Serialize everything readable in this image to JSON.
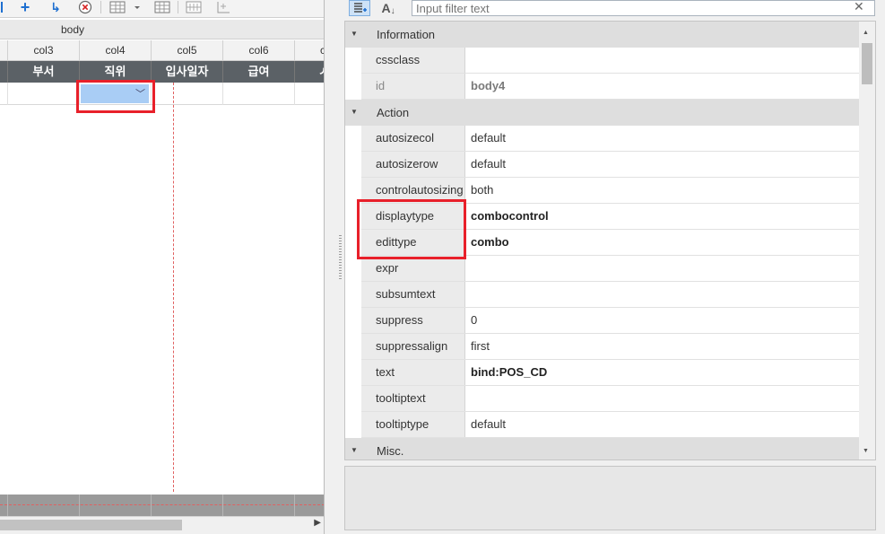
{
  "grid": {
    "band_label": "body",
    "columns": [
      "col3",
      "col4",
      "col5",
      "col6",
      "c"
    ],
    "headers": [
      "부서",
      "직위",
      "입사일자",
      "급여",
      "ㅅ"
    ]
  },
  "filter": {
    "placeholder": "Input filter text"
  },
  "categories": [
    {
      "name": "Information",
      "rows": [
        {
          "name": "cssclass",
          "value": ""
        },
        {
          "name": "id",
          "value": "body4"
        }
      ]
    },
    {
      "name": "Action",
      "rows": [
        {
          "name": "autosizecol",
          "value": "default"
        },
        {
          "name": "autosizerow",
          "value": "default"
        },
        {
          "name": "controlautosizing",
          "value": "both"
        },
        {
          "name": "displaytype",
          "value": "combocontrol"
        },
        {
          "name": "edittype",
          "value": "combo"
        },
        {
          "name": "expr",
          "value": ""
        },
        {
          "name": "subsumtext",
          "value": ""
        },
        {
          "name": "suppress",
          "value": "0"
        },
        {
          "name": "suppressalign",
          "value": "first"
        },
        {
          "name": "text",
          "value": "bind:POS_CD"
        },
        {
          "name": "tooltiptext",
          "value": ""
        },
        {
          "name": "tooltiptype",
          "value": "default"
        }
      ]
    },
    {
      "name": "Misc.",
      "rows": []
    }
  ],
  "colors": {
    "highlight": "#e8202a",
    "selected_cell": "#a9cdf5",
    "header_bg": "#5b6166"
  },
  "icons": {
    "toolbar": [
      "add-icon",
      "redirect-arrow-icon",
      "delete-circle-icon",
      "grid-dropdown-icon",
      "table-icon",
      "merge-icon",
      "split-icon"
    ],
    "panel": [
      "categorized-view-icon",
      "sort-alpha-icon",
      "clear-filter-icon"
    ]
  }
}
